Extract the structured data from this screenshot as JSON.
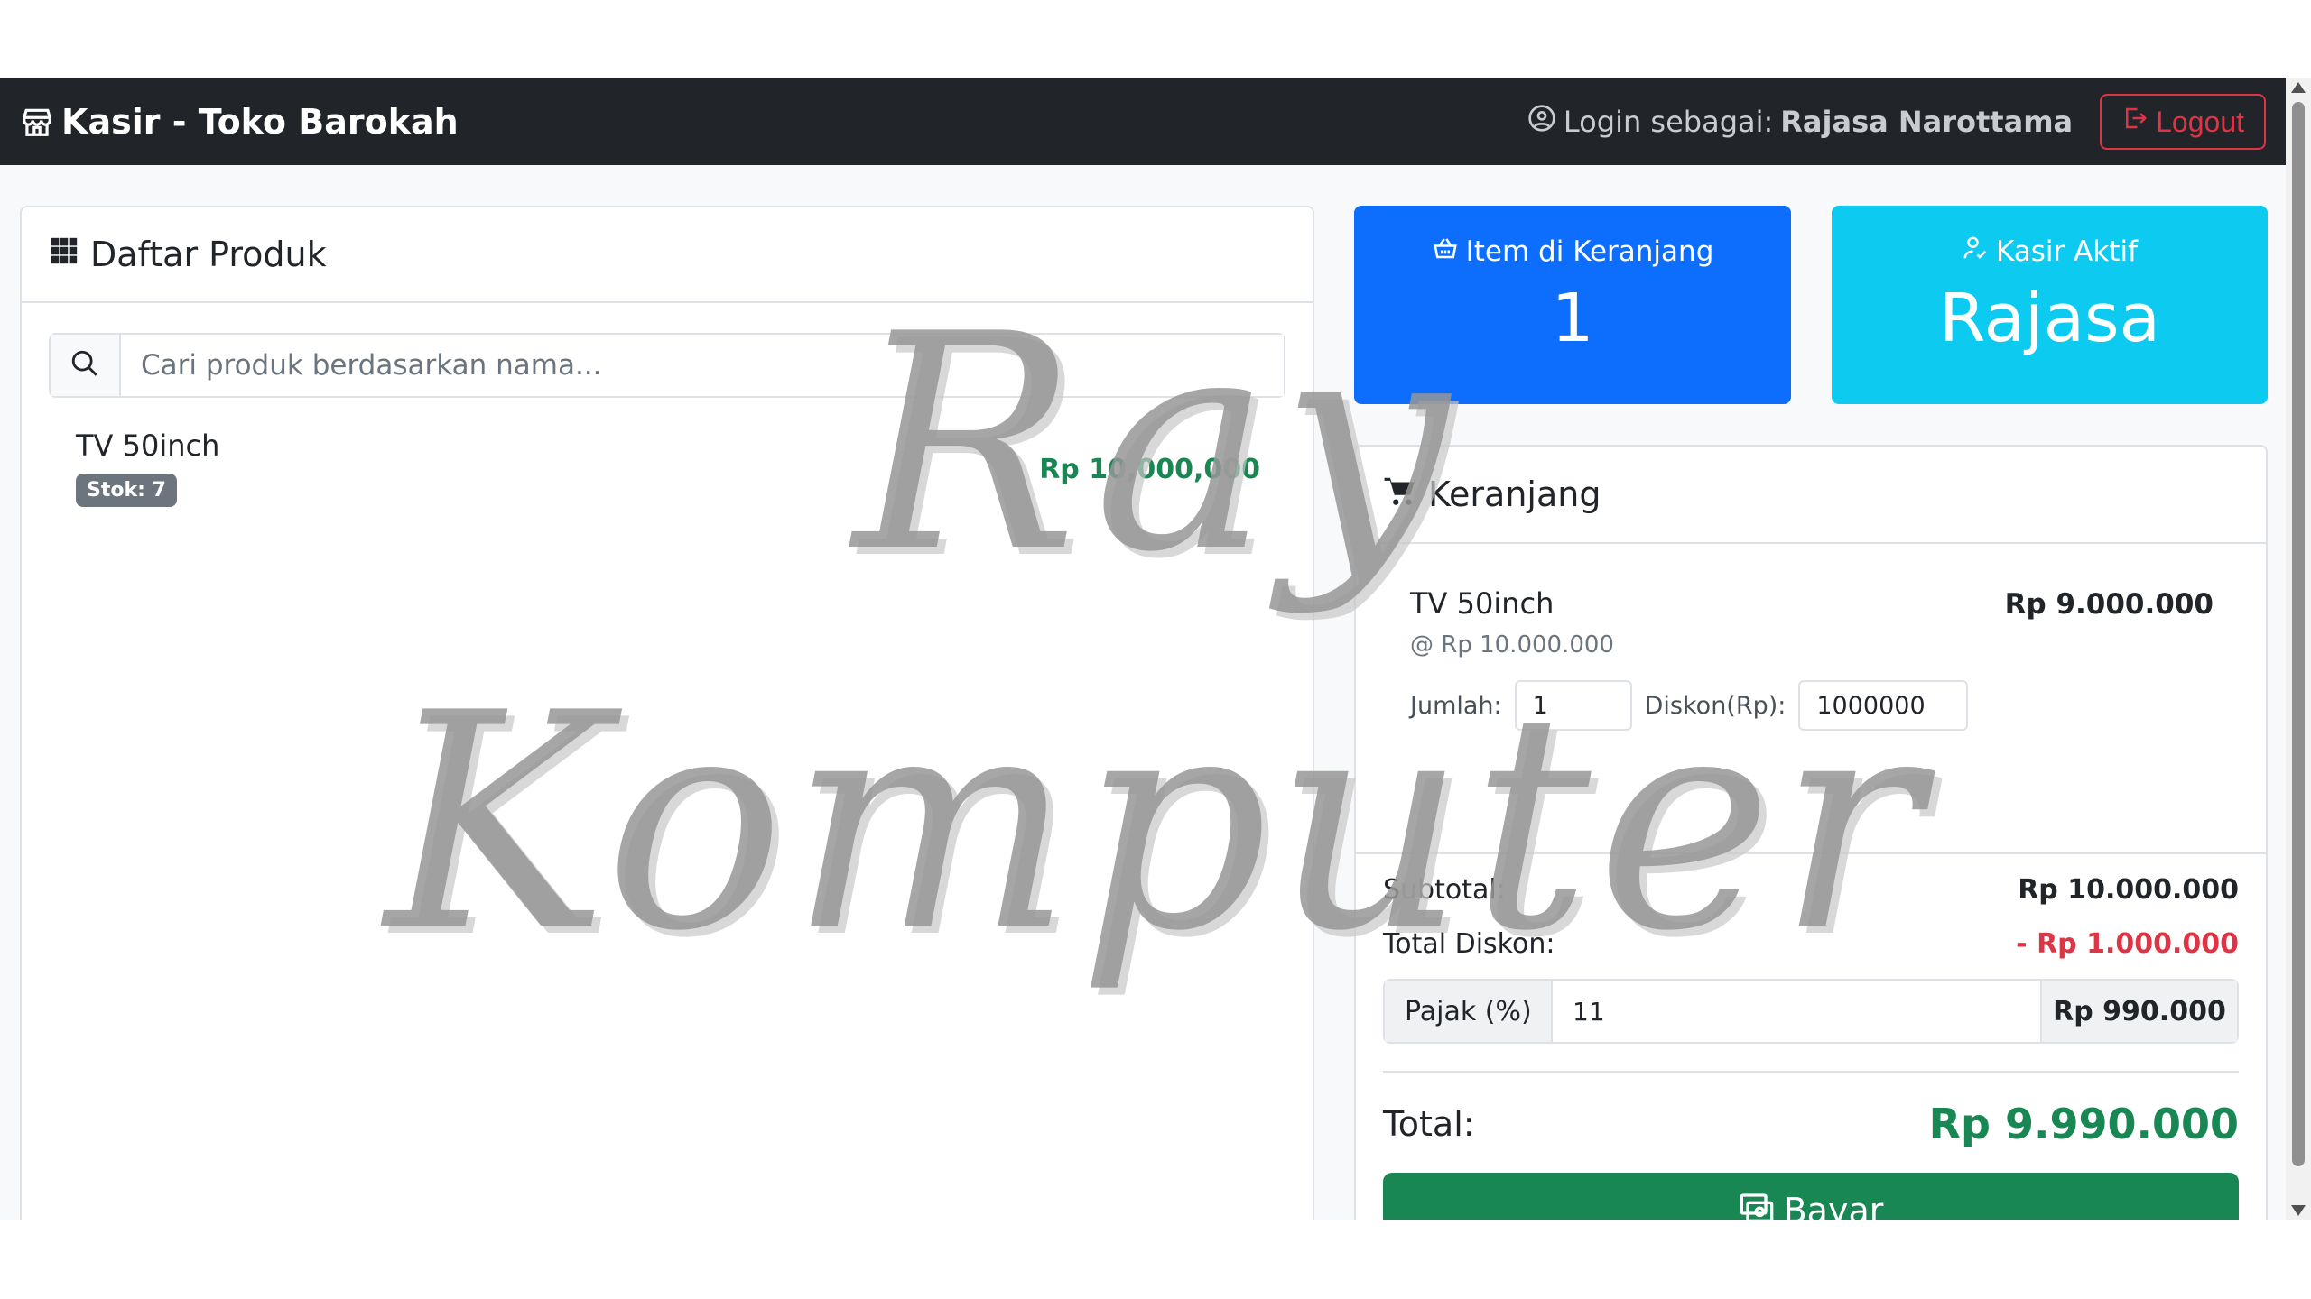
{
  "navbar": {
    "brand_title": "Kasir - Toko Barokah",
    "login_prefix": "Login sebagai:",
    "login_user": "Rajasa Narottama",
    "logout_label": "Logout"
  },
  "products_panel": {
    "title": "Daftar Produk",
    "search_placeholder": "Cari produk berdasarkan nama...",
    "items": [
      {
        "name": "TV 50inch",
        "stock": "Stok: 7",
        "price": "Rp 10,000,000"
      }
    ]
  },
  "stats": {
    "cart_label": "Item di Keranjang",
    "cart_count": "1",
    "cashier_label": "Kasir Aktif",
    "cashier_name": "Rajasa"
  },
  "cart": {
    "title": "Keranjang",
    "items": [
      {
        "name": "TV 50inch",
        "unit_price": "@ Rp 10.000.000",
        "line_total": "Rp 9.000.000",
        "qty_label": "Jumlah:",
        "qty": "1",
        "discount_label": "Diskon(Rp):",
        "discount": "1000000"
      }
    ],
    "subtotal_label": "Subtotal:",
    "subtotal": "Rp 10.000.000",
    "discount_total_label": "Total Diskon:",
    "discount_total": "- Rp 1.000.000",
    "tax_label": "Pajak (%)",
    "tax_percent": "11",
    "tax_amount": "Rp 990.000",
    "total_label": "Total:",
    "total": "Rp 9.990.000",
    "pay_label": "Bayar"
  },
  "watermark": {
    "line1": "Ray",
    "line2": "Komputer"
  },
  "colors": {
    "navbar": "#212529",
    "primary": "#0d6efd",
    "info": "#0dcaf0",
    "success": "#198754",
    "danger": "#dc3545"
  }
}
